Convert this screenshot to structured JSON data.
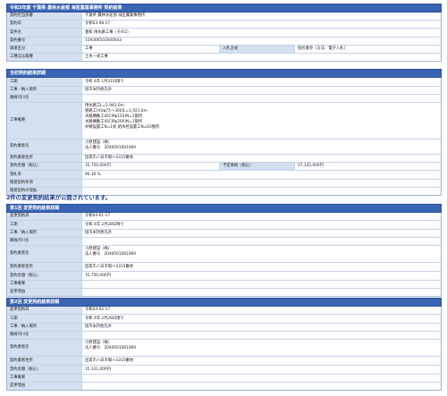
{
  "header": {
    "title": "令和3年度 千葉県 農林水産部 海匝農業事務所 契約結果"
  },
  "main": [
    {
      "label": "契約担当部署",
      "value": "千葉県 農林水産部 海匝農業事務所"
    },
    {
      "label": "契約日",
      "value": "令和03-08-17"
    },
    {
      "label": "案件名",
      "value": "豊和 用水路工事（その2）"
    },
    {
      "label": "契約番号",
      "value": "159300503000043"
    },
    {
      "label": "調達区分",
      "value": "工事",
      "label2": "入札方式",
      "value2": "指名競争（方法：電子入札）"
    },
    {
      "label": "工種又は業種",
      "value": "土木一式工事"
    }
  ],
  "detail_title": "当初契約結果詳細",
  "detail": [
    {
      "label": "工期",
      "value": "令和 4年 1月31日限り"
    },
    {
      "label": "工事／納入場所",
      "value": "旭市米持他先外"
    },
    {
      "label": "路線河川名",
      "value": ""
    },
    {
      "label": "工事概要",
      "value": "用水路工L=1,943.0m\n管路工(VUφ75〜300)L=1,921.0m\n水路構動工(DCIPφ150)N=1箇所\n水路構動工(DCIPφ200)N=1箇所\n弁類設置工N=1式 給水栓設置工N=63箇所"
    },
    {
      "label": "契約業者名",
      "value": "小原建設（株）\n法人番号　2040001061069"
    },
    {
      "label": "契約業者住所",
      "value": "匝瑳市八日市場ハ3315番地"
    },
    {
      "label": "契約金額（税込）",
      "value": "35,750,000円",
      "label2": "予定価格（税込）",
      "value2": "37,125,000円"
    },
    {
      "label": "落札率",
      "value": "96.30 %"
    },
    {
      "label": "随意契約条項",
      "value": ""
    },
    {
      "label": "随意契約の理由",
      "value": ""
    }
  ],
  "change_notice": "2件の変更契約結果が公開されています。",
  "change1_title": "第1回 変更契約結果詳細",
  "change1": [
    {
      "label": "変更契約日",
      "value": "令和04-01-17"
    },
    {
      "label": "工期",
      "value": "令和 4年 2月28日限り"
    },
    {
      "label": "工事／納入場所",
      "value": "旭市米持他先外"
    },
    {
      "label": "路線河川名",
      "value": ""
    },
    {
      "label": "契約業者名",
      "value": "小原建設（株）\n法人番号　2040001061069"
    },
    {
      "label": "契約業者住所",
      "value": "匝瑳市八日市場ハ3315番地"
    },
    {
      "label": "契約金額（税込）",
      "value": "35,750,000円"
    },
    {
      "label": "工事概要",
      "value": ""
    },
    {
      "label": "変更理由",
      "value": ""
    }
  ],
  "change2_title": "第2回 変更契約結果詳細",
  "change2": [
    {
      "label": "変更契約日",
      "value": "令和04-02-17"
    },
    {
      "label": "工期",
      "value": "令和 4年 2月28日限り"
    },
    {
      "label": "工事／納入場所",
      "value": "旭市米持他先外"
    },
    {
      "label": "路線河川名",
      "value": ""
    },
    {
      "label": "契約業者名",
      "value": "小原建設（株）\n法人番号　2040001061069"
    },
    {
      "label": "契約業者住所",
      "value": "匝瑳市八日市場ハ3315番地"
    },
    {
      "label": "契約金額（税込）",
      "value": "35,321,000円"
    },
    {
      "label": "工事概要",
      "value": ""
    },
    {
      "label": "変更理由",
      "value": ""
    }
  ]
}
